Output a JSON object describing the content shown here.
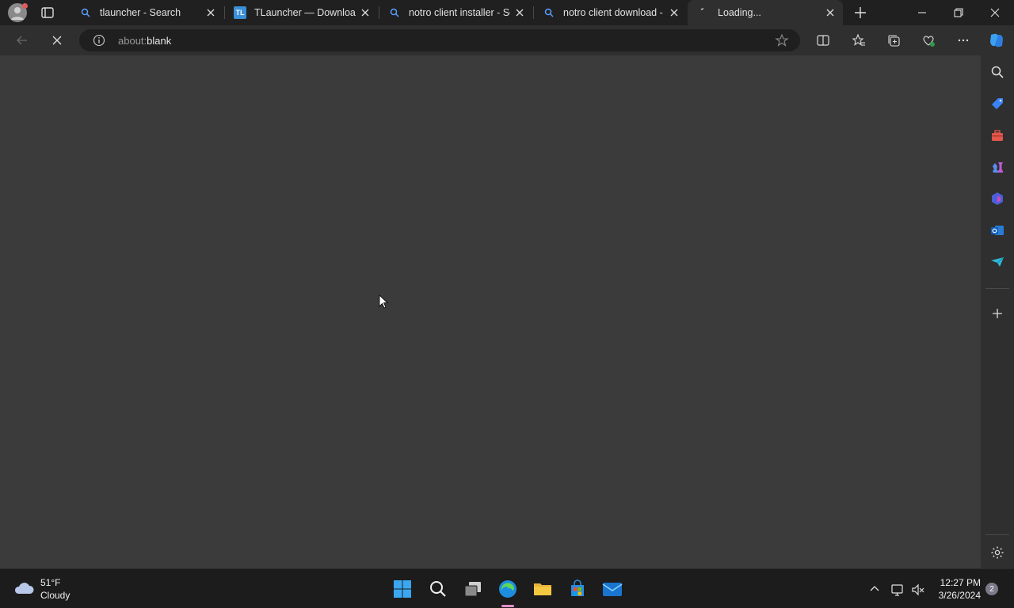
{
  "browser": {
    "tabs": [
      {
        "title": "tlauncher - Search",
        "favicon": "search-icon"
      },
      {
        "title": "TLauncher — Download",
        "favicon": "tl-logo"
      },
      {
        "title": "notro client installer - Se",
        "favicon": "search-icon"
      },
      {
        "title": "notro client download -",
        "favicon": "search-icon"
      },
      {
        "title": "Loading...",
        "favicon": "loading-icon"
      }
    ],
    "address": {
      "scheme": "about:",
      "rest": "blank"
    },
    "favicon_tl_text": "TL"
  },
  "taskbar": {
    "weather": {
      "temp": "51°F",
      "condition": "Cloudy"
    },
    "clock": {
      "time": "12:27 PM",
      "date": "3/26/2024"
    },
    "notifications": "2"
  },
  "colors": {
    "accent": "#1e90ff",
    "content_bg": "#3b3b3b",
    "chrome_bg": "#2f2f2f"
  }
}
